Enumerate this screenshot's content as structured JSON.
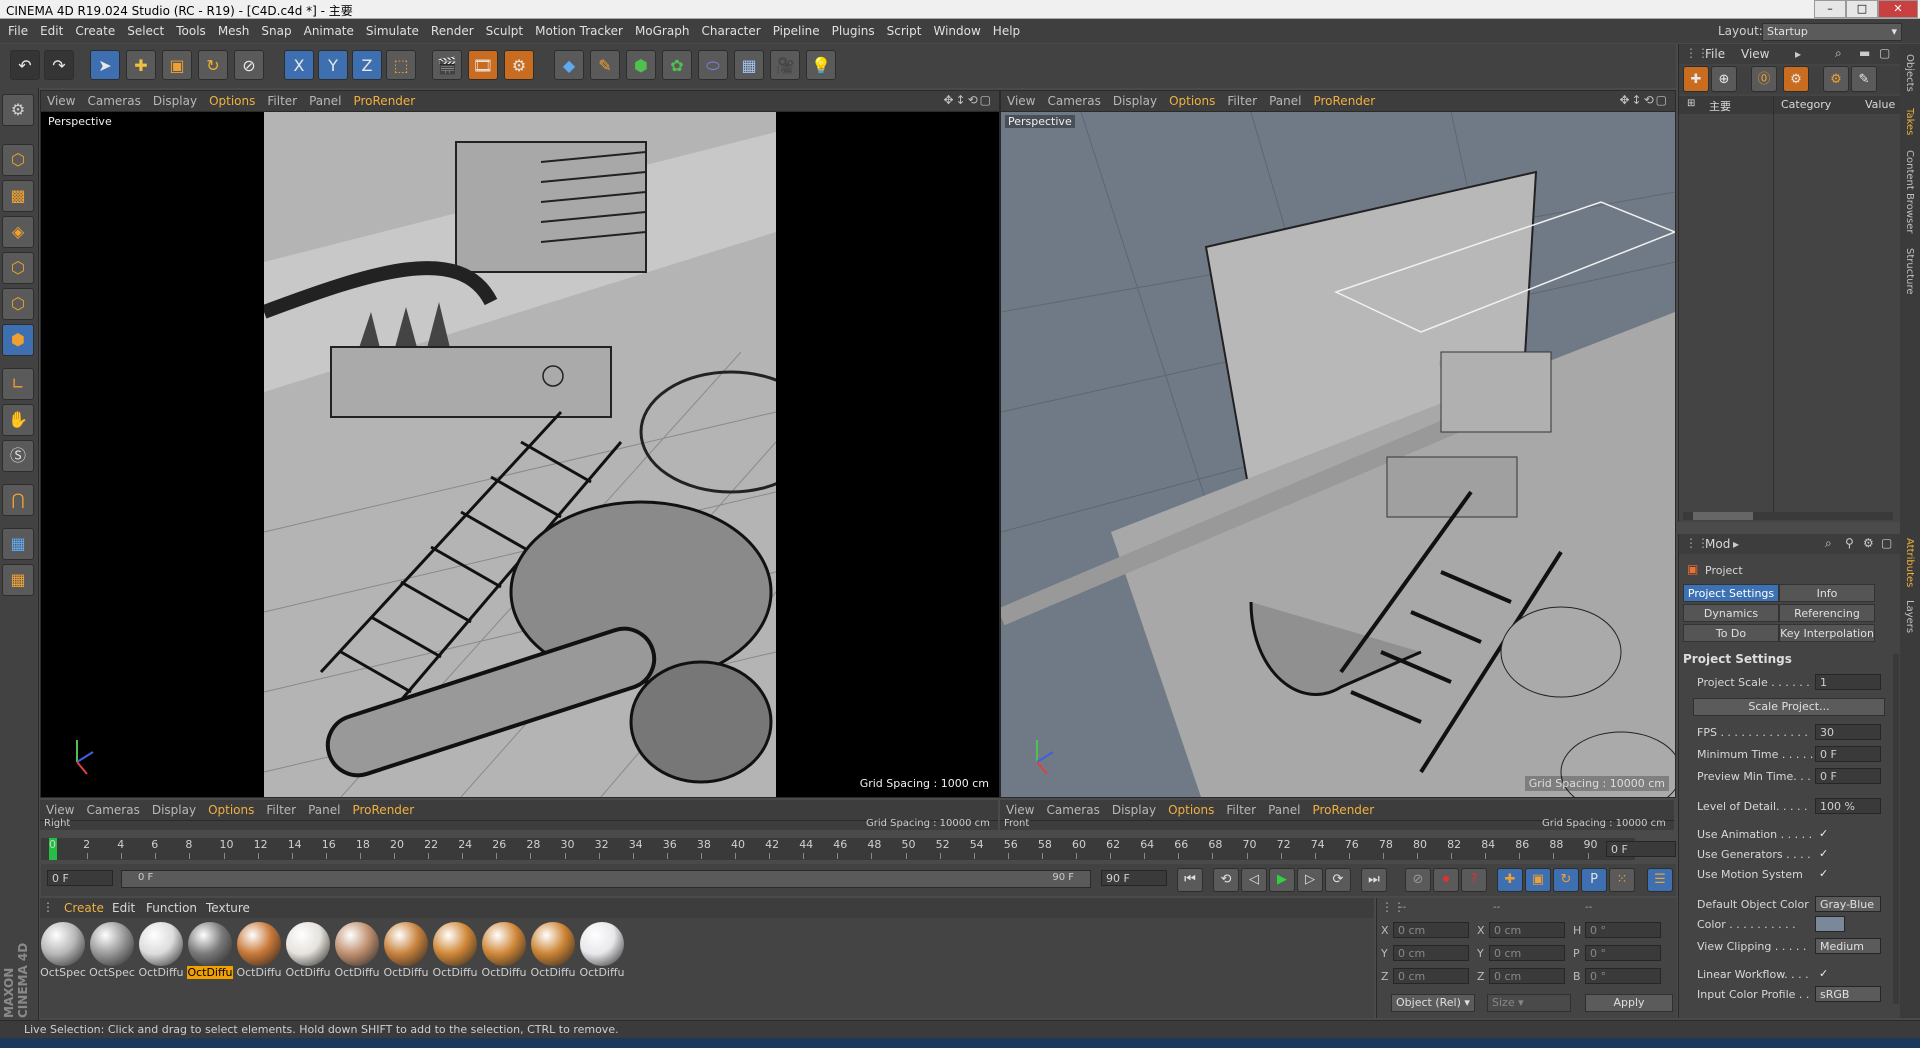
{
  "window": {
    "title": "CINEMA 4D R19.024 Studio (RC - R19) - [C4D.c4d *] - 主要",
    "controls": [
      "–",
      "□",
      "✕"
    ]
  },
  "menubar": {
    "items": [
      "File",
      "Edit",
      "Create",
      "Select",
      "Tools",
      "Mesh",
      "Snap",
      "Animate",
      "Simulate",
      "Render",
      "Sculpt",
      "Motion Tracker",
      "MoGraph",
      "Character",
      "Pipeline",
      "Plugins",
      "Script",
      "Window",
      "Help"
    ],
    "layout_label": "Layout:",
    "layout_value": "Startup"
  },
  "viewports": {
    "menu": [
      "View",
      "Cameras",
      "Display",
      "Options",
      "Filter",
      "Panel",
      "ProRender"
    ],
    "left": {
      "label": "Perspective",
      "grid": "Grid Spacing : 1000 cm"
    },
    "right": {
      "label": "Perspective",
      "grid": "Grid Spacing : 10000 cm"
    },
    "bottom_left_label": "Right",
    "bottom_left_grid": "Grid Spacing : 10000 cm",
    "bottom_right_label": "Front",
    "bottom_right_grid": "Grid Spacing : 10000 cm"
  },
  "timeline": {
    "ticks": [
      "0",
      "2",
      "4",
      "6",
      "8",
      "10",
      "12",
      "14",
      "16",
      "18",
      "20",
      "22",
      "24",
      "26",
      "28",
      "30",
      "32",
      "34",
      "36",
      "38",
      "40",
      "42",
      "44",
      "46",
      "48",
      "50",
      "52",
      "54",
      "56",
      "58",
      "60",
      "62",
      "64",
      "66",
      "68",
      "70",
      "72",
      "74",
      "76",
      "78",
      "80",
      "82",
      "84",
      "86",
      "88",
      "90"
    ],
    "current": "0 F",
    "start_field": "0 F",
    "range_start": "0 F",
    "range_end": "90 F",
    "end_field": "90 F"
  },
  "materials": {
    "menu": [
      "Create",
      "Edit",
      "Function",
      "Texture"
    ],
    "items": [
      {
        "label": "OctSpec",
        "color": "#b8b8b8",
        "selected": false
      },
      {
        "label": "OctSpec",
        "color": "#9a9a9a",
        "selected": false
      },
      {
        "label": "OctDiffu",
        "color": "#dcdcdc",
        "selected": false
      },
      {
        "label": "OctDiffu",
        "color": "#7a7a7a",
        "selected": true
      },
      {
        "label": "OctDiffu",
        "color": "#c87838",
        "selected": false
      },
      {
        "label": "OctDiffu",
        "color": "#e6e2dc",
        "selected": false
      },
      {
        "label": "OctDiffu",
        "color": "#c09070",
        "selected": false
      },
      {
        "label": "OctDiffu",
        "color": "#c8823c",
        "selected": false
      },
      {
        "label": "OctDiffu",
        "color": "#d08838",
        "selected": false
      },
      {
        "label": "OctDiffu",
        "color": "#d08838",
        "selected": false
      },
      {
        "label": "OctDiffu",
        "color": "#cc8434",
        "selected": false
      },
      {
        "label": "OctDiffu",
        "color": "#e8e8ec",
        "selected": false
      }
    ]
  },
  "coords": {
    "headers": [
      "--",
      "--",
      "--"
    ],
    "rows": [
      {
        "a": "X",
        "av": "0 cm",
        "b": "X",
        "bv": "0 cm",
        "c": "H",
        "cv": "0 °"
      },
      {
        "a": "Y",
        "av": "0 cm",
        "b": "Y",
        "bv": "0 cm",
        "c": "P",
        "cv": "0 °"
      },
      {
        "a": "Z",
        "av": "0 cm",
        "b": "Z",
        "bv": "0 cm",
        "c": "B",
        "cv": "0 °"
      }
    ],
    "mode": "Object (Rel)",
    "size": "Size",
    "apply": "Apply"
  },
  "objects_panel": {
    "menu": [
      "File",
      "View"
    ],
    "root_item": "主要",
    "col_category": "Category",
    "col_value": "Value"
  },
  "attributes": {
    "mode": "Mod",
    "title": "Project",
    "tabs": [
      "Project Settings",
      "Info",
      "Dynamics",
      "Referencing",
      "To Do",
      "Key Interpolation"
    ],
    "section": "Project Settings",
    "rows": [
      {
        "label": "Project Scale . . . . . .",
        "value": "1"
      },
      {
        "label": "FPS . . . . . . . . . . . . .",
        "value": "30"
      },
      {
        "label": "Minimum Time . . . . .",
        "value": "0 F"
      },
      {
        "label": "Preview Min Time. . .",
        "value": "0 F"
      },
      {
        "label": "Level of Detail. . . . .",
        "value": "100 %"
      },
      {
        "label": "Use Animation . . . . .",
        "value": "✓"
      },
      {
        "label": "Use Generators . . . .",
        "value": "✓"
      },
      {
        "label": "Use Motion System",
        "value": "✓"
      },
      {
        "label": "Default Object Color",
        "value": "Gray-Blue"
      },
      {
        "label": "Color . . . . . . . . . .",
        "value": ""
      },
      {
        "label": "View Clipping . . . . .",
        "value": "Medium"
      },
      {
        "label": "Linear Workflow. . . .",
        "value": "✓"
      },
      {
        "label": "Input Color Profile . .",
        "value": "sRGB"
      }
    ],
    "scale_button": "Scale Project..."
  },
  "side_tabs_top": [
    "Objects",
    "Takes",
    "Content Browser",
    "Structure"
  ],
  "side_tabs_bottom": [
    "Attributes",
    "Layers"
  ],
  "left_brand": "MAXON CINEMA 4D",
  "status": "Live Selection: Click and drag to select elements. Hold down SHIFT to add to the selection, CTRL to remove.",
  "accent": "#f0a000",
  "select_blue": "#3c72b4"
}
